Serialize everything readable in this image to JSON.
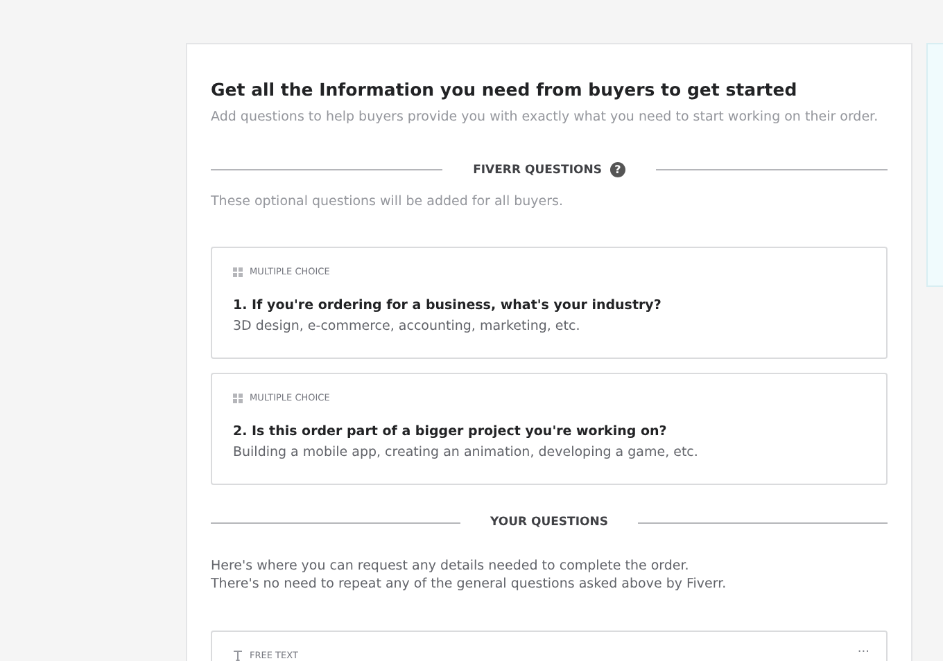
{
  "header": {
    "title": "Get all the Information you need from buyers to get started",
    "subtitle": "Add questions to help buyers provide you with exactly what you need to start working on their order."
  },
  "fiverr_section": {
    "heading": "FIVERR QUESTIONS",
    "help": "?",
    "note": "These optional questions will be added for all buyers."
  },
  "fiverr_questions": [
    {
      "kind": "multiple_choice",
      "type_label": "MULTIPLE CHOICE",
      "question": "1. If you're ordering for a business, what's your industry?",
      "hint": "3D design, e-commerce, accounting, marketing, etc."
    },
    {
      "kind": "multiple_choice",
      "type_label": "MULTIPLE CHOICE",
      "question": "2. Is this order part of a bigger project you're working on?",
      "hint": "Building a mobile app, creating an animation, developing a game, etc."
    }
  ],
  "your_section": {
    "heading": "YOUR QUESTIONS",
    "note_lines": [
      "Here's where you can request any details needed to complete the order.",
      "There's no need to repeat any of the general questions asked above by Fiverr."
    ]
  },
  "your_questions": [
    {
      "kind": "free_text",
      "type_label": "FREE TEXT",
      "menu": "···"
    }
  ]
}
